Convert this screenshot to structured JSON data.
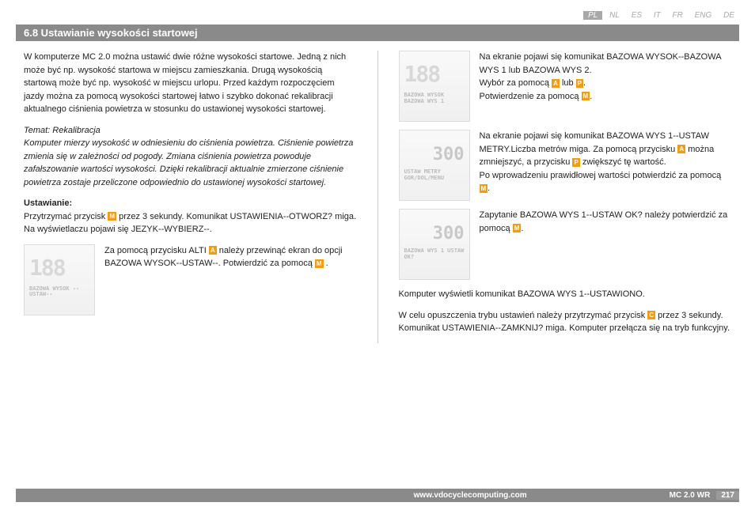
{
  "langs": [
    "PL",
    "NL",
    "ES",
    "IT",
    "FR",
    "ENG",
    "DE"
  ],
  "activeLang": "PL",
  "header": "6.8 Ustawianie wysokości startowej",
  "left": {
    "p1": "W komputerze MC 2.0 można ustawić dwie różne wysokości startowe. Jedną z nich może być np. wysokość startowa w miejscu zamieszkania. Drugą wysokością startową może być np. wysokość w miejscu urlopu. Przed każdym rozpoczęciem jazdy można za pomocą wysokości startowej łatwo i szybko dokonać rekalibracji aktualnego ciśnienia powietrza w stosunku do ustawionej wysokości startowej.",
    "p2title": "Temat: Rekalibracja",
    "p2": "Komputer mierzy wysokość w odniesieniu do ciśnienia powietrza. Ciśnienie powietrza zmienia się w zależności od pogody. Zmiana ciśnienia powietrza powoduje zafałszowanie wartości wysokości. Dzięki rekalibracji aktualnie zmierzone ciśnienie powietrza zostaje przeliczone odpowiednio do ustawionej wysokości startowej.",
    "p3title": "Ustawianie:",
    "p3a": "Przytrzymać przycisk ",
    "p3b": " przez 3 sekundy. Komunikat USTAWIENIA--OTWORZ? miga. Na wyświetlaczu pojawi się JEZYK--WYBIERZ--.",
    "p4a": "Za pomocą przycisku ALTI ",
    "p4b": " należy przewinąć ekran do opcji BAZOWA WYSOK--USTAW--. Potwierdzić za pomocą ",
    "p4c": " .",
    "thumb1sub": "BAZOWA WYSOK\n--USTAW--"
  },
  "right": {
    "r1a": "Na ekranie pojawi się komunikat BAZOWA WYSOK--BAZOWA WYS 1 lub BAZOWA WYS 2.",
    "r1b": "Wybór za pomocą ",
    "r1c": " lub ",
    "r1d": ".",
    "r1e": "Potwierdzenie za pomocą ",
    "r1f": ".",
    "r2a": "Na ekranie pojawi się komunikat BAZOWA WYS 1--USTAW METRY.Liczba metrów miga. Za pomocą przycisku ",
    "r2b": " można zmniejszyć, a przycisku ",
    "r2c": " zwiększyć tę wartość.",
    "r2d": "Po wprowadzeniu prawidłowej wartości potwierdzić za pomocą ",
    "r2e": ".",
    "r3a": "Zapytanie BAZOWA WYS 1--USTAW OK? należy potwierdzić za pomocą ",
    "r3b": ".",
    "p4": "Komputer wyświetli komunikat BAZOWA WYS 1--USTAWIONO.",
    "p5a": "W celu opuszczenia trybu ustawień należy przytrzymać przycisk ",
    "p5b": " przez 3 sekundy. Komunikat USTAWIENIA--ZAMKNIJ? miga. Komputer przełącza się na tryb funkcyjny.",
    "thumb1sub": "BAZOWA WYSOK\nBAZOWA WYS 1",
    "thumb2num": "300",
    "thumb2sub": "USTAW METRY\nGOR/DOL/MENU",
    "thumb3num": "300",
    "thumb3sub": "BAZOWA WYS 1\nUSTAW OK?"
  },
  "footer": {
    "url": "www.vdocyclecomputing.com",
    "model": "MC 2.0 WR",
    "page": "217"
  },
  "buttons": {
    "M": "M",
    "A": "A",
    "P": "P",
    "C": "C"
  }
}
